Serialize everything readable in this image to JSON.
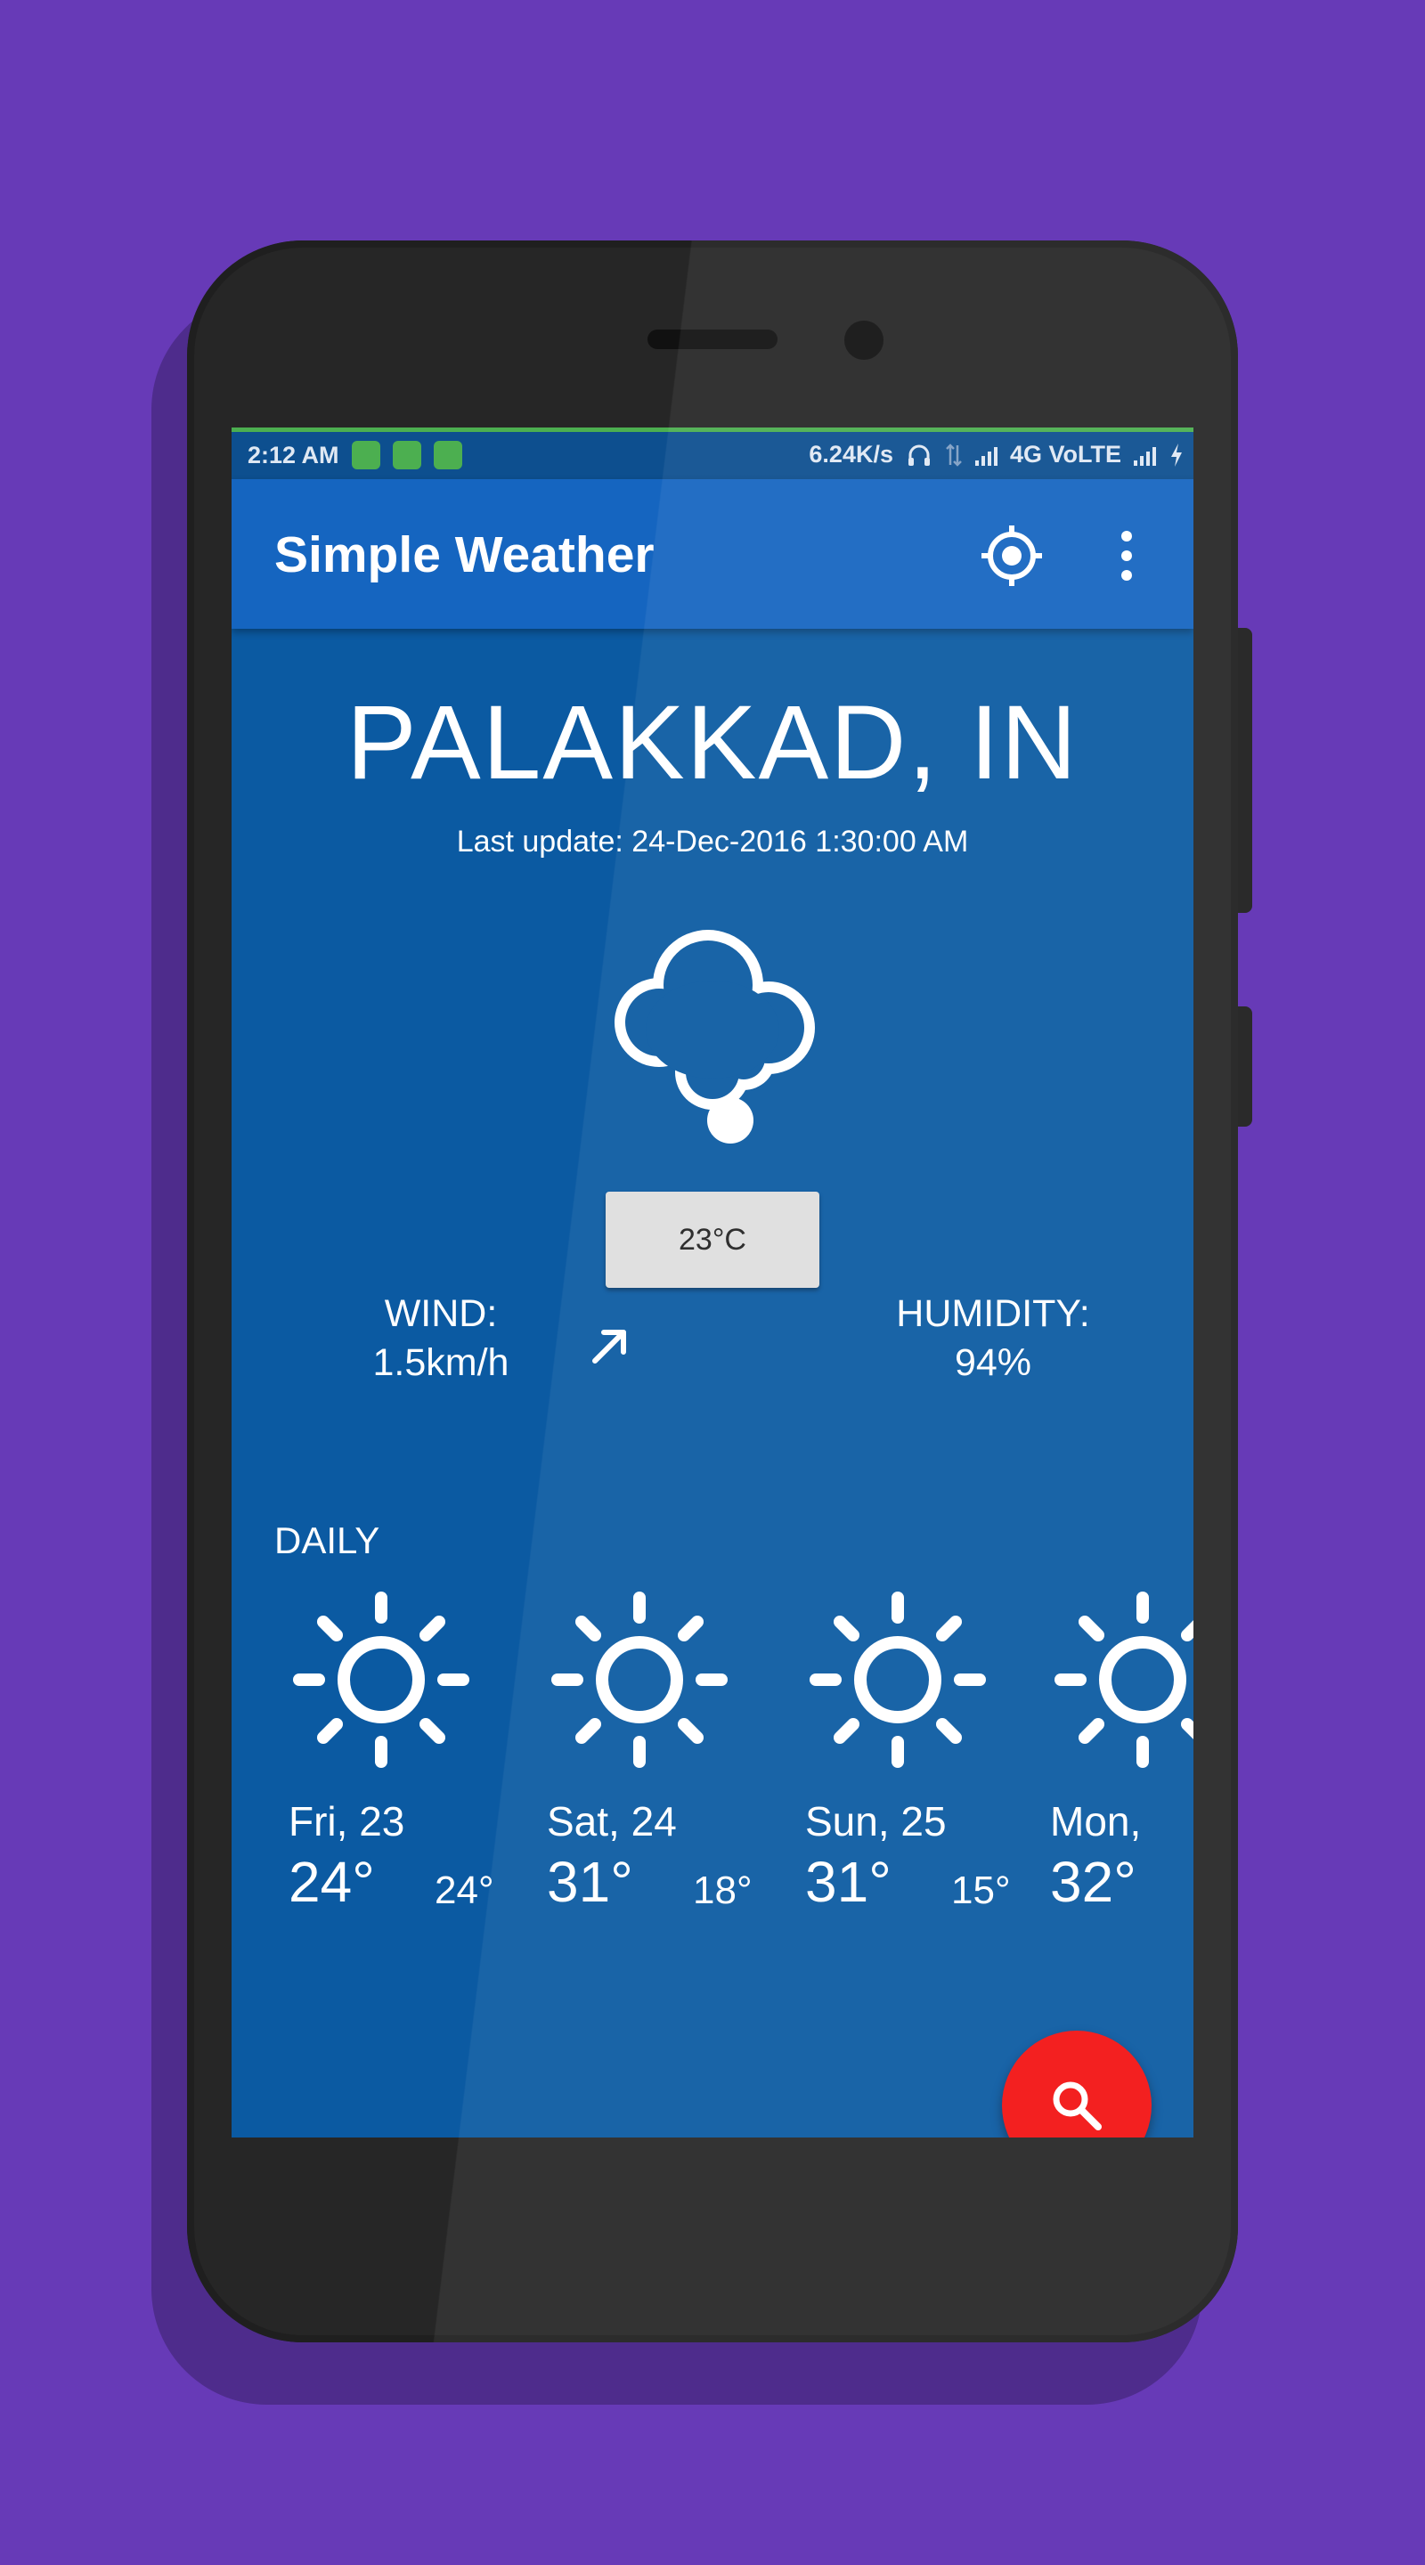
{
  "status_bar": {
    "time": "2:12 AM",
    "speed": "6.24K/s",
    "network": "4G VoLTE",
    "notification_icons": [
      "shield-icon",
      "battery-app-icon",
      "android-icon"
    ]
  },
  "app_bar": {
    "title": "Simple Weather",
    "actions": [
      "my-location-icon",
      "more-vert-icon"
    ]
  },
  "weather": {
    "city": "PALAKKAD, IN",
    "last_update": "Last update: 24-Dec-2016 1:30:00 AM",
    "condition_icon": "cloud-icon",
    "temperature": "23°C",
    "wind_label": "WIND:",
    "wind_value": "1.5km/h",
    "humidity_label": "HUMIDITY:",
    "humidity_value": "94%"
  },
  "daily": {
    "title": "DAILY",
    "days": [
      {
        "name": "Fri, 23",
        "high": "24°",
        "low": "24°",
        "icon": "sun-icon"
      },
      {
        "name": "Sat, 24",
        "high": "31°",
        "low": "18°",
        "icon": "sun-icon"
      },
      {
        "name": "Sun, 25",
        "high": "31°",
        "low": "15°",
        "icon": "sun-icon"
      },
      {
        "name": "Mon,",
        "high": "32°",
        "low": "",
        "icon": "sun-icon"
      }
    ]
  },
  "fab": {
    "icon": "search-icon"
  },
  "colors": {
    "background": "#673ab7",
    "app_bar": "#1565c0",
    "screen": "#0b5aa2",
    "fab": "#f21212",
    "status_accent": "#4caf50"
  }
}
